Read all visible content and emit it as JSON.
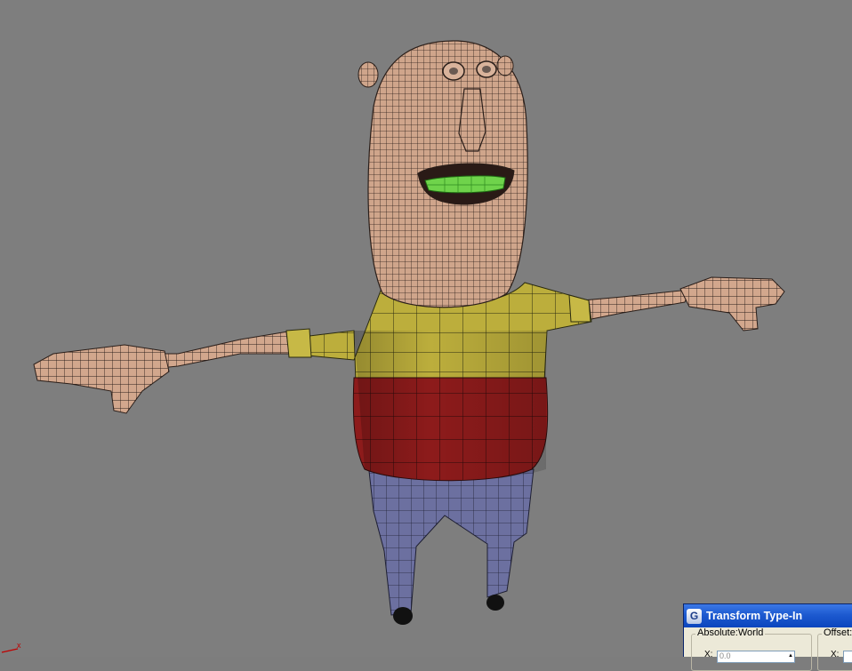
{
  "viewport": {
    "background": "#7e7e7e",
    "gizmo_axis": "x"
  },
  "dialog": {
    "title": "Transform Type-In",
    "icon": "3dsmax-icon",
    "absolute_group": {
      "label": "Absolute:World",
      "axis": "X:",
      "value": "0.0"
    },
    "offset_group": {
      "label": "Offset:",
      "axis": "X:"
    }
  },
  "colors": {
    "skin": "#d2a78d",
    "wire": "#2a1d18",
    "shirt_yellow": "#b9ab3a",
    "shirt_red": "#8a1a1a",
    "pants": "#6b6f9c",
    "teeth": "#6ed24a",
    "titlebar": "#0b45bd"
  }
}
